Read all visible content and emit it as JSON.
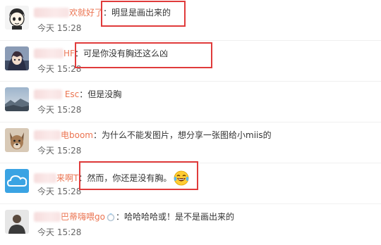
{
  "comments": [
    {
      "name_visible": "欢就好了",
      "text": "明显是画出来的",
      "time": "今天 15:28",
      "avatar_icon": "cartoon-boy-avatar-icon"
    },
    {
      "name_visible": "HF",
      "text": "可是你没有胸还这么凶",
      "time": "今天 15:28",
      "avatar_icon": "anime-avatar-icon"
    },
    {
      "name_visible": "Esc",
      "text": "但是没胸",
      "time": "今天 15:28",
      "avatar_icon": "landscape-avatar-icon"
    },
    {
      "name_visible": "电boom",
      "text": "为什么不能发图片，想分享一张图给小miis的",
      "time": "今天 15:28",
      "avatar_icon": "dog-avatar-icon"
    },
    {
      "name_visible": "来啊T",
      "text": "然而，你还是没有胸。",
      "time": "今天 15:28",
      "avatar_icon": "cloud-avatar-icon",
      "emoji": "laughing-tears-emoji-icon"
    },
    {
      "name_visible": "巴蒂嗨喂go",
      "text": "哈哈哈哈或！是不是画出来的",
      "time": "今天 15:28",
      "avatar_icon": "person-avatar-icon",
      "badge": "ring-badge-icon"
    }
  ],
  "separator": "：",
  "colors": {
    "username": "#eb7350",
    "highlight_border": "#e03b3b",
    "time": "#666666",
    "text": "#333333"
  }
}
